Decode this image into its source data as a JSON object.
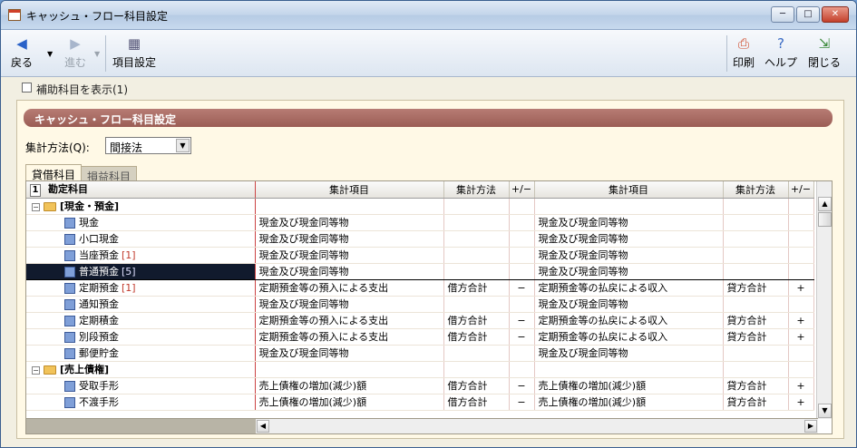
{
  "window": {
    "title": "キャッシュ・フロー科目設定",
    "controls": {
      "minimize": "─",
      "maximize": "□",
      "close": "✕"
    }
  },
  "toolbar": {
    "back_label": "戻る",
    "forward_label": "進む",
    "settings_label": "項目設定",
    "print_label": "印刷",
    "help_label": "ヘルプ",
    "close_label": "閉じる"
  },
  "options": {
    "show_sub_accounts_label": "補助科目を表示(1)"
  },
  "panel": {
    "header": "キャッシュ・フロー科目設定",
    "method_label": "集計方法(Q):",
    "method_value": "間接法"
  },
  "tabs": [
    {
      "label": "貸借科目",
      "active": true
    },
    {
      "label": "損益科目",
      "active": false
    }
  ],
  "grid": {
    "headers": {
      "num": "1",
      "account": "勘定科目",
      "item1": "集計項目",
      "method1": "集計方法",
      "sign1": "+/−",
      "item2": "集計項目",
      "method2": "集計方法",
      "sign2": "+/−"
    },
    "rows": [
      {
        "type": "group",
        "name": "[現金・預金]",
        "item1": "",
        "method1": "",
        "sign1": "",
        "item2": "",
        "method2": "",
        "sign2": ""
      },
      {
        "type": "leaf",
        "name": "現金",
        "count": "",
        "item1": "現金及び現金同等物",
        "method1": "",
        "sign1": "",
        "item2": "現金及び現金同等物",
        "method2": "",
        "sign2": ""
      },
      {
        "type": "leaf",
        "name": "小口現金",
        "count": "",
        "item1": "現金及び現金同等物",
        "method1": "",
        "sign1": "",
        "item2": "現金及び現金同等物",
        "method2": "",
        "sign2": ""
      },
      {
        "type": "leaf",
        "name": "当座預金",
        "count": "[1]",
        "item1": "現金及び現金同等物",
        "method1": "",
        "sign1": "",
        "item2": "現金及び現金同等物",
        "method2": "",
        "sign2": ""
      },
      {
        "type": "leaf",
        "selected": true,
        "name": "普通預金",
        "count": "[5]",
        "item1": "現金及び現金同等物",
        "method1": "",
        "sign1": "",
        "item2": "現金及び現金同等物",
        "method2": "",
        "sign2": ""
      },
      {
        "type": "leaf",
        "name": "定期預金",
        "count": "[1]",
        "item1": "定期預金等の預入による支出",
        "method1": "借方合計",
        "sign1": "−",
        "item2": "定期預金等の払戻による収入",
        "method2": "貸方合計",
        "sign2": "+"
      },
      {
        "type": "leaf",
        "name": "通知預金",
        "count": "",
        "item1": "現金及び現金同等物",
        "method1": "",
        "sign1": "",
        "item2": "現金及び現金同等物",
        "method2": "",
        "sign2": ""
      },
      {
        "type": "leaf",
        "name": "定期積金",
        "count": "",
        "item1": "定期預金等の預入による支出",
        "method1": "借方合計",
        "sign1": "−",
        "item2": "定期預金等の払戻による収入",
        "method2": "貸方合計",
        "sign2": "+"
      },
      {
        "type": "leaf",
        "name": "別段預金",
        "count": "",
        "item1": "定期預金等の預入による支出",
        "method1": "借方合計",
        "sign1": "−",
        "item2": "定期預金等の払戻による収入",
        "method2": "貸方合計",
        "sign2": "+"
      },
      {
        "type": "leaf",
        "name": "郵便貯金",
        "count": "",
        "item1": "現金及び現金同等物",
        "method1": "",
        "sign1": "",
        "item2": "現金及び現金同等物",
        "method2": "",
        "sign2": ""
      },
      {
        "type": "group",
        "name": "[売上債権]",
        "item1": "",
        "method1": "",
        "sign1": "",
        "item2": "",
        "method2": "",
        "sign2": ""
      },
      {
        "type": "leaf",
        "name": "受取手形",
        "count": "",
        "item1": "売上債権の増加(減少)額",
        "method1": "借方合計",
        "sign1": "−",
        "item2": "売上債権の増加(減少)額",
        "method2": "貸方合計",
        "sign2": "+"
      },
      {
        "type": "leaf",
        "name": "不渡手形",
        "count": "",
        "item1": "売上債権の増加(減少)額",
        "method1": "借方合計",
        "sign1": "−",
        "item2": "売上債権の増加(減少)額",
        "method2": "貸方合計",
        "sign2": "+"
      }
    ]
  },
  "colors": {
    "header_bar": "#a86a62",
    "selection": "#111a2d",
    "divider": "#cc4444"
  }
}
